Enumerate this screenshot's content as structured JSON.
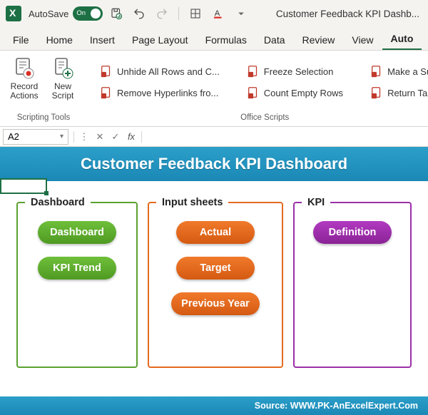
{
  "titlebar": {
    "autosave_label": "AutoSave",
    "autosave_state": "On",
    "doc_title": "Customer Feedback KPI Dashb..."
  },
  "ribbon_tabs": [
    "File",
    "Home",
    "Insert",
    "Page Layout",
    "Formulas",
    "Data",
    "Review",
    "View",
    "Auto"
  ],
  "active_tab_index": 8,
  "ribbon": {
    "scripting_tools": {
      "label": "Scripting Tools",
      "record": "Record Actions",
      "new_script": "New Script"
    },
    "office_scripts": {
      "label": "Office Scripts",
      "col1": [
        "Unhide All Rows and C...",
        "Remove Hyperlinks fro..."
      ],
      "col2": [
        "Freeze Selection",
        "Count Empty Rows"
      ],
      "col3": [
        "Make a Su",
        "Return Tab"
      ]
    }
  },
  "formula_bar": {
    "namebox": "A2",
    "fx": "fx"
  },
  "dashboard": {
    "title": "Customer Feedback KPI Dashboard",
    "footer": "Source: WWW.PK-AnExcelExpert.Com",
    "groups": {
      "dashboard": {
        "legend": "Dashboard",
        "buttons": [
          "Dashboard",
          "KPI Trend"
        ]
      },
      "input": {
        "legend": "Input sheets",
        "buttons": [
          "Actual",
          "Target",
          "Previous Year"
        ]
      },
      "kpi": {
        "legend": "KPI",
        "buttons": [
          "Definition"
        ]
      }
    }
  }
}
